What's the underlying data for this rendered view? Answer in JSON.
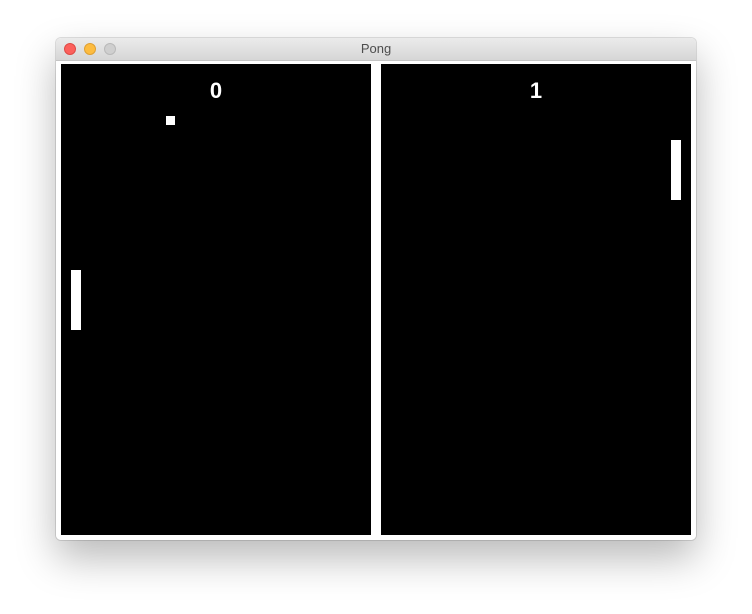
{
  "window": {
    "title": "Pong"
  },
  "game": {
    "left_score": "0",
    "right_score": "1"
  },
  "colors": {
    "court": "#000000",
    "divider": "#ffffff",
    "pieces": "#ffffff"
  }
}
